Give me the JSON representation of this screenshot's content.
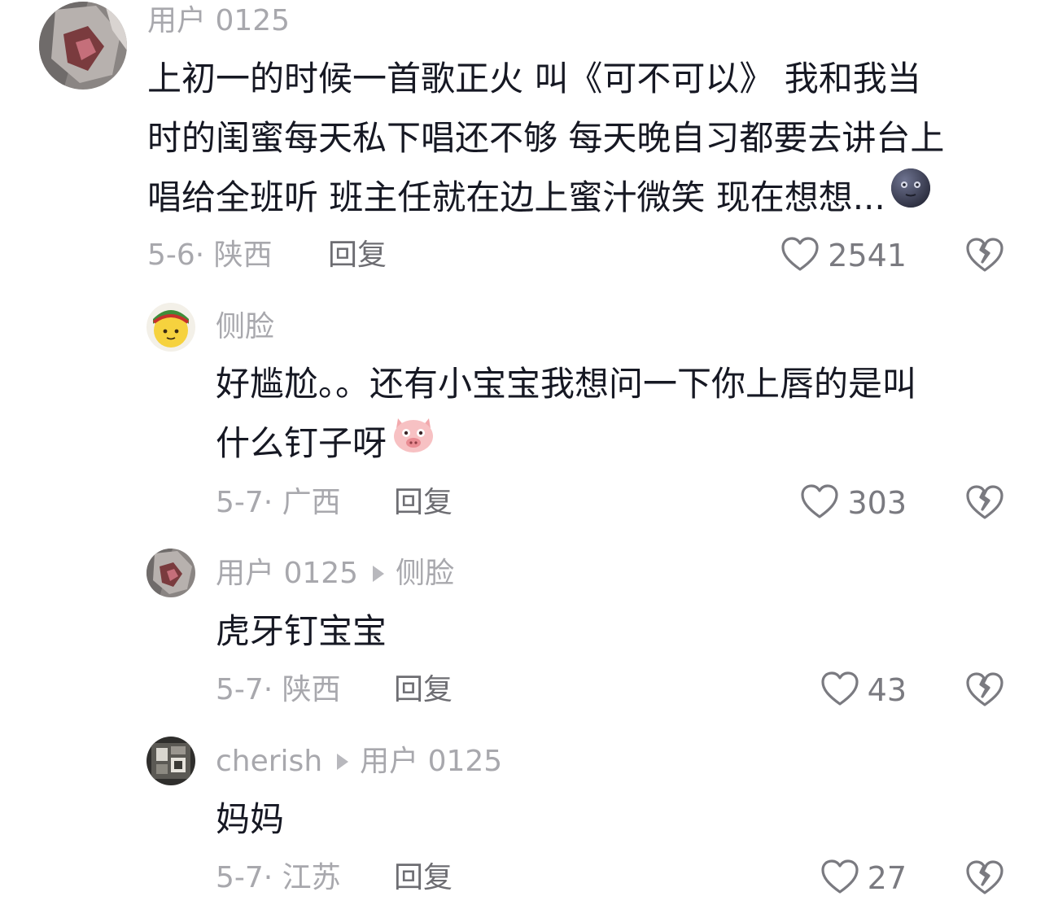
{
  "comments": [
    {
      "username": "用户 0125",
      "reply_to": "",
      "content_lines": [
        "上初一的时候一首歌正火 叫《可不可以》 我和我当",
        "时的闺蜜每天私下唱还不够 每天晚自习都要去讲台上",
        "唱给全班听 班主任就在边上蜜汁微笑 现在想想..."
      ],
      "emoji": "moon-face-emoji",
      "date_location": "5-6· 陕西",
      "reply_label": "回复",
      "like_count": "2541"
    },
    {
      "username": "侧脸",
      "reply_to": "",
      "content_lines": [
        "好尴尬。。还有小宝宝我想问一下你上唇的是叫",
        "什么钉子呀"
      ],
      "emoji": "pig-face-emoji",
      "date_location": "5-7· 广西",
      "reply_label": "回复",
      "like_count": "303"
    },
    {
      "username": "用户 0125",
      "reply_to": "侧脸",
      "content_lines": [
        "虎牙钉宝宝"
      ],
      "emoji": "",
      "date_location": "5-7· 陕西",
      "reply_label": "回复",
      "like_count": "43"
    },
    {
      "username": "cherish",
      "reply_to": "用户 0125",
      "content_lines": [
        "妈妈"
      ],
      "emoji": "",
      "date_location": "5-7· 江苏",
      "reply_label": "回复",
      "like_count": "27"
    }
  ],
  "colors": {
    "text": "#161823",
    "muted": "#a8a8ad",
    "reply": "#6d6d72",
    "icon": "#7a7a80"
  },
  "icons": {
    "like": "heart-outline-icon",
    "dislike": "broken-heart-icon",
    "reply_arrow": "triangle-right-icon"
  }
}
